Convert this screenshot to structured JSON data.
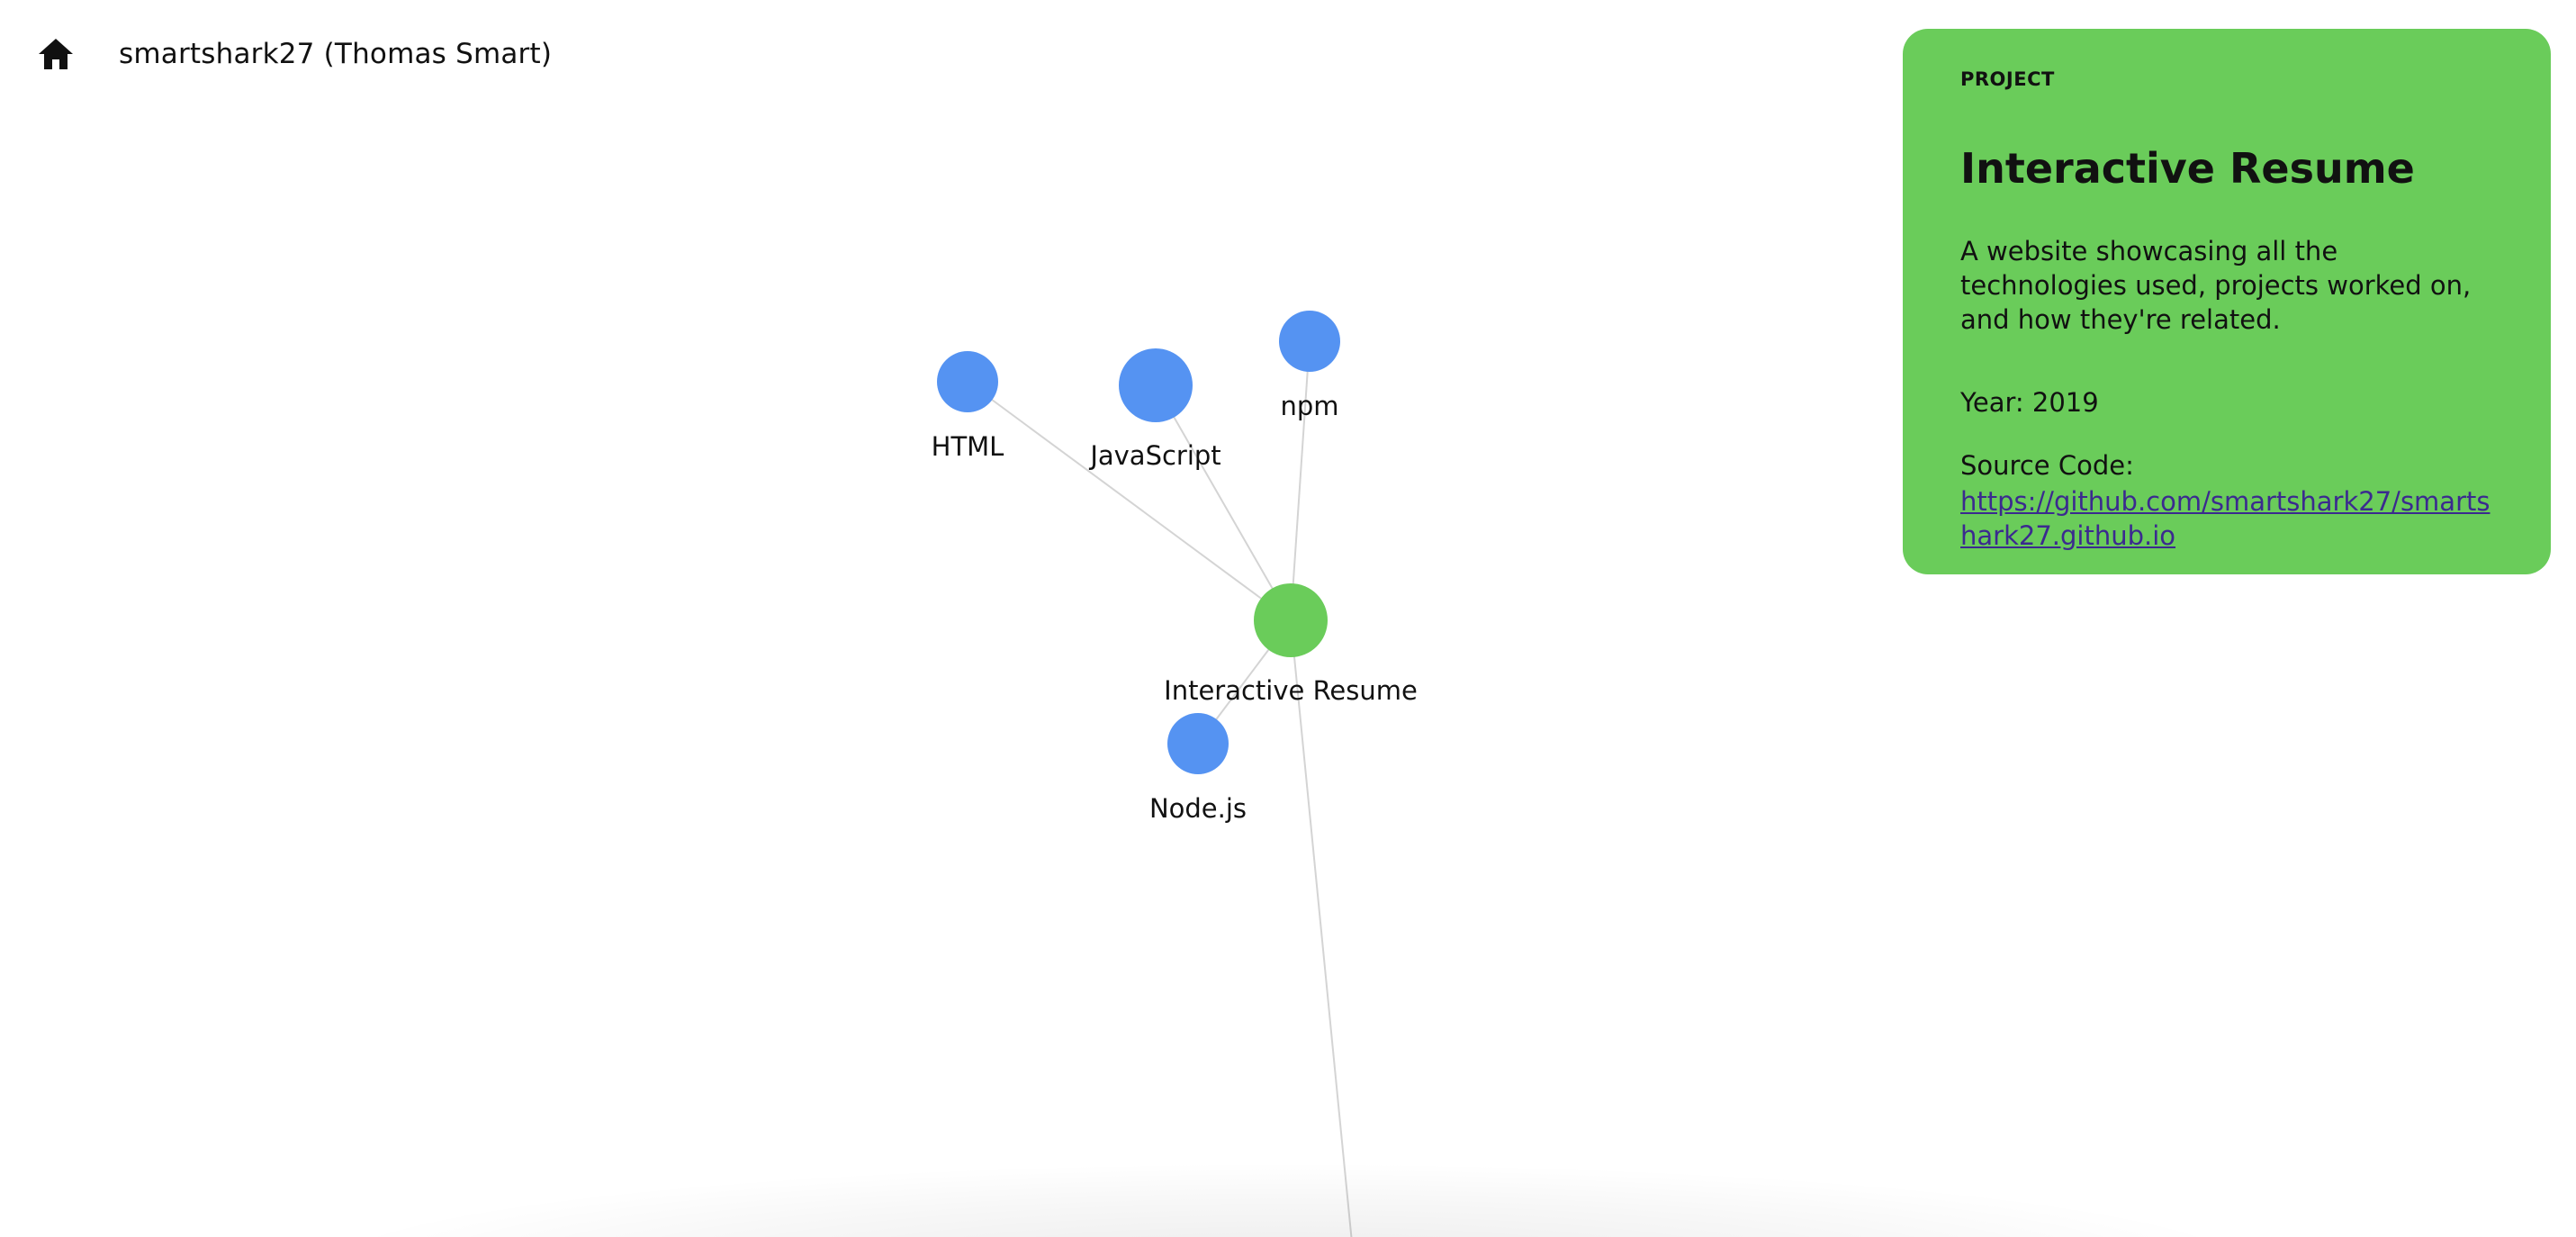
{
  "header": {
    "home_icon": "home-icon",
    "title": "smartshark27 (Thomas Smart)"
  },
  "graph": {
    "colors": {
      "project": "#6acc5a",
      "technology": "#5593f2",
      "edge": "#d4d4d4"
    },
    "nodes": [
      {
        "id": "html",
        "label": "HTML",
        "kind": "technology"
      },
      {
        "id": "javascript",
        "label": "JavaScript",
        "kind": "technology"
      },
      {
        "id": "npm",
        "label": "npm",
        "kind": "technology"
      },
      {
        "id": "interactive-resume",
        "label": "Interactive Resume",
        "kind": "project"
      },
      {
        "id": "nodejs",
        "label": "Node.js",
        "kind": "technology"
      }
    ],
    "edges": [
      {
        "from": "interactive-resume",
        "to": "html"
      },
      {
        "from": "interactive-resume",
        "to": "javascript"
      },
      {
        "from": "interactive-resume",
        "to": "npm"
      },
      {
        "from": "interactive-resume",
        "to": "nodejs"
      },
      {
        "from": "interactive-resume",
        "to": "offscreen"
      }
    ]
  },
  "card": {
    "kicker": "PROJECT",
    "title": "Interactive Resume",
    "description": "A website showcasing all the technologies used, projects worked on, and how they're related.",
    "year": "Year: 2019",
    "source_label": "Source Code:",
    "source_url": "https://github.com/smartshark27/smartshark27.github.io",
    "background": "#6acc5a"
  }
}
